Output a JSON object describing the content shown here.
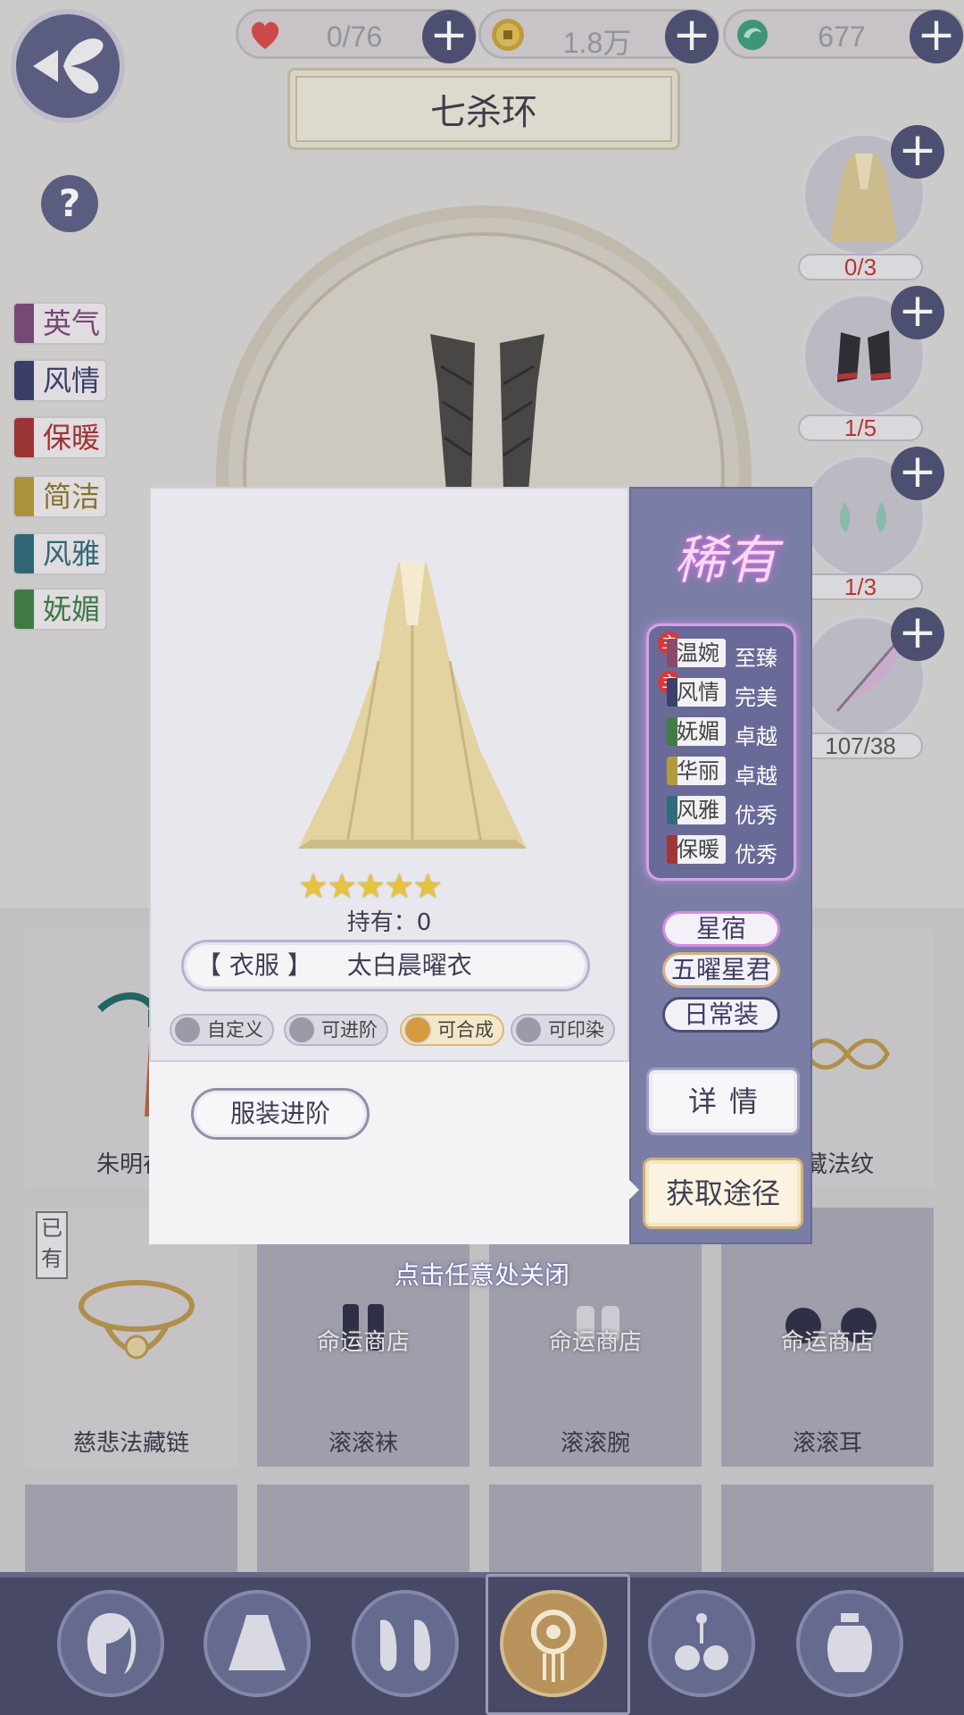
{
  "header": {
    "resources": [
      {
        "icon": "heart-icon",
        "value": "0/76",
        "color": "#d94a4a"
      },
      {
        "icon": "coin-icon",
        "value": "1.8万",
        "color": "#c9a23d"
      },
      {
        "icon": "jade-icon",
        "value": "677",
        "color": "#3f9d7c"
      }
    ],
    "title": "七杀环"
  },
  "left_attributes": [
    {
      "label": "英气",
      "color": "#7a4a78"
    },
    {
      "label": "风情",
      "color": "#3a3f6e"
    },
    {
      "label": "保暖",
      "color": "#a33434"
    },
    {
      "label": "简洁",
      "color": "#b39a3b"
    },
    {
      "label": "风雅",
      "color": "#2f6b7a"
    },
    {
      "label": "妩媚",
      "color": "#3f7f45"
    }
  ],
  "materials": [
    {
      "name": "dress",
      "count": "0/3",
      "enough": false
    },
    {
      "name": "boots",
      "count": "1/5",
      "enough": false
    },
    {
      "name": "earrings",
      "count": "1/3",
      "enough": false
    },
    {
      "name": "feather",
      "count": "107/38",
      "enough": true
    }
  ],
  "grid": {
    "row1": [
      {
        "name": "朱明在",
        "shop": ""
      },
      {
        "name": "",
        "shop": ""
      },
      {
        "name": "",
        "shop": ""
      },
      {
        "name": "法藏法纹",
        "shop": ""
      }
    ],
    "row2": [
      {
        "name": "慈悲法藏链",
        "shop": ""
      },
      {
        "name": "滚滚袜",
        "shop": "命运商店"
      },
      {
        "name": "滚滚腕",
        "shop": "命运商店"
      },
      {
        "name": "滚滚耳",
        "shop": "命运商店"
      }
    ],
    "owned_label": "已有"
  },
  "modal": {
    "rarity": "稀有",
    "stars": "★★★★★",
    "owned": "持有：0",
    "category": "【 衣服 】",
    "item_name": "太白晨曜衣",
    "features": [
      {
        "label": "自定义",
        "highlight": false
      },
      {
        "label": "可进阶",
        "highlight": false
      },
      {
        "label": "可合成",
        "highlight": true
      },
      {
        "label": "可印染",
        "highlight": false
      }
    ],
    "upgrade_button": "服装进阶",
    "attributes": [
      {
        "name": "温婉",
        "level": "至臻",
        "main": true,
        "main_label": "主",
        "color": "#8a4a6a"
      },
      {
        "name": "风情",
        "level": "完美",
        "main": true,
        "main_label": "主",
        "color": "#3a3f6e"
      },
      {
        "name": "妩媚",
        "level": "卓越",
        "main": false,
        "color": "#3f7f45"
      },
      {
        "name": "华丽",
        "level": "卓越",
        "main": false,
        "color": "#b39a3b"
      },
      {
        "name": "风雅",
        "level": "优秀",
        "main": false,
        "color": "#2f6b7a"
      },
      {
        "name": "保暖",
        "level": "优秀",
        "main": false,
        "color": "#a33434"
      }
    ],
    "tags": [
      "星宿",
      "五曜星君",
      "日常装"
    ],
    "detail_button": "详情",
    "obtain_button": "获取途径",
    "close_hint": "点击任意处关闭"
  },
  "bottom_nav": [
    {
      "icon": "hairstyle-icon",
      "active": false
    },
    {
      "icon": "dress-icon",
      "active": false
    },
    {
      "icon": "shoes-icon",
      "active": false
    },
    {
      "icon": "accessory-icon",
      "active": true
    },
    {
      "icon": "bells-icon",
      "active": false
    },
    {
      "icon": "jar-icon",
      "active": false
    }
  ]
}
